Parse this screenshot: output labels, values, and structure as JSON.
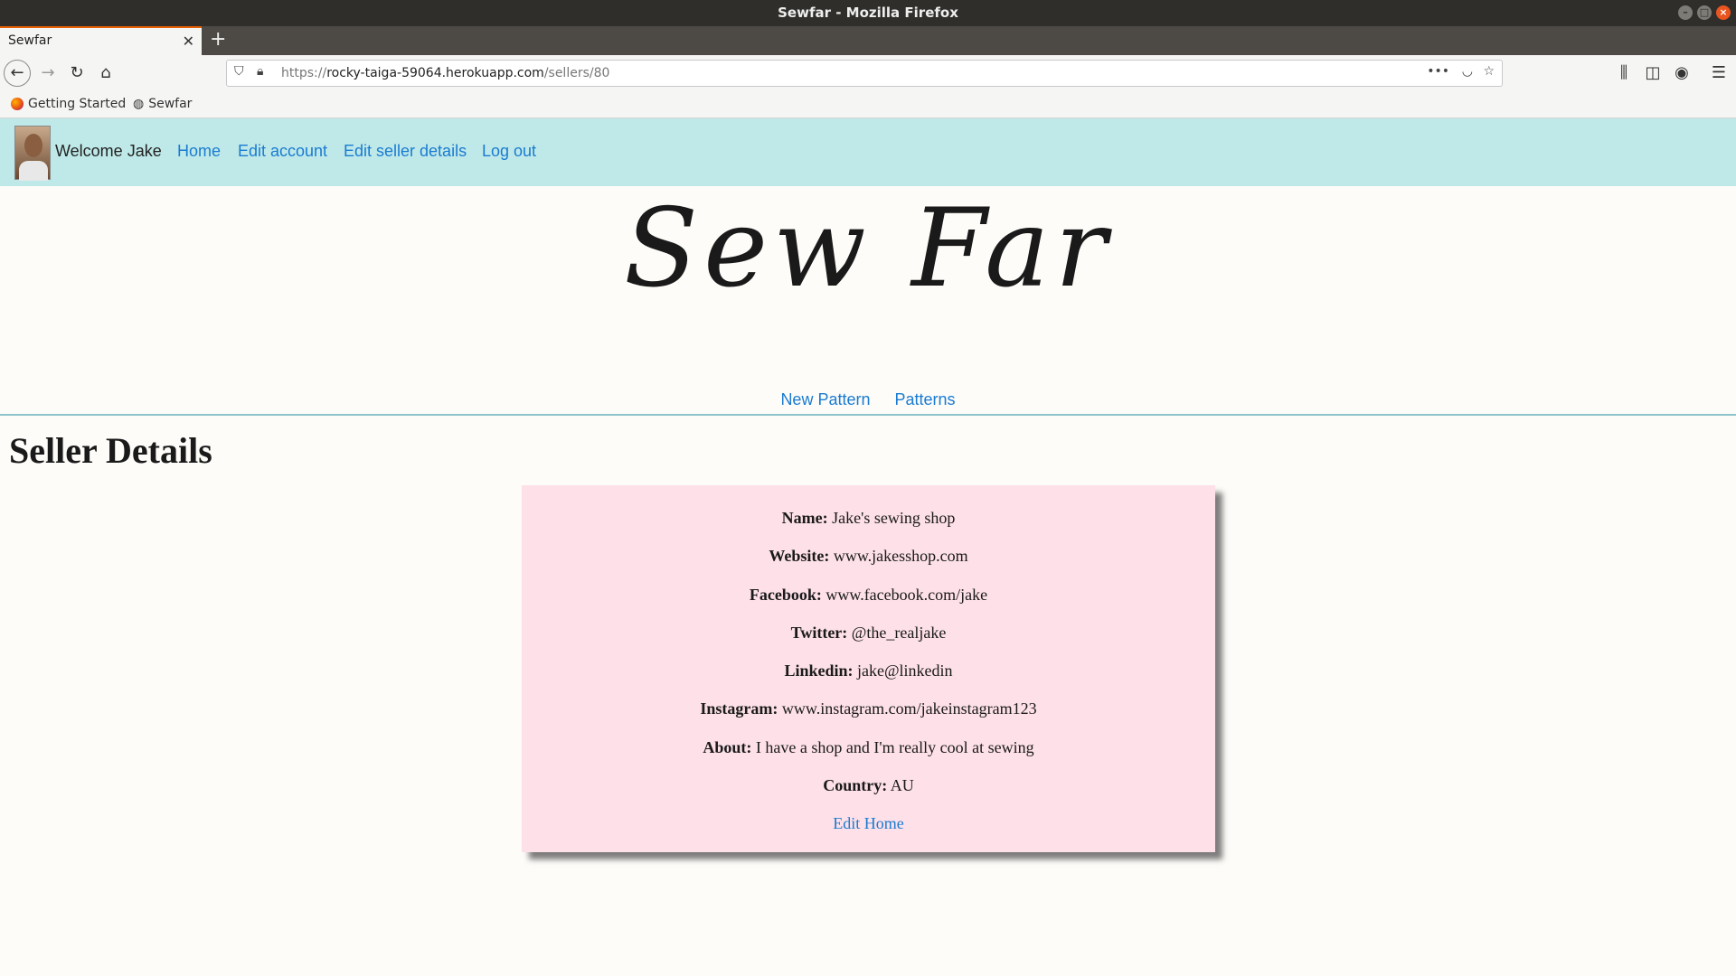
{
  "window": {
    "title": "Sewfar - Mozilla Firefox"
  },
  "browser": {
    "tab_title": "Sewfar",
    "url_scheme": "https://",
    "url_host": "rocky-taiga-59064.herokuapp.com",
    "url_path": "/sellers/80",
    "bookmarks": [
      "Getting Started",
      "Sewfar"
    ]
  },
  "header": {
    "welcome": "Welcome Jake",
    "links": [
      "Home",
      "Edit account",
      "Edit seller details",
      "Log out"
    ]
  },
  "logo": {
    "text": "Sew Far"
  },
  "subnav": {
    "links": [
      "New Pattern",
      "Patterns"
    ]
  },
  "page": {
    "title": "Seller Details"
  },
  "seller": {
    "fields": [
      {
        "label": "Name:",
        "value": "Jake's sewing shop"
      },
      {
        "label": "Website:",
        "value": "www.jakesshop.com"
      },
      {
        "label": "Facebook:",
        "value": "www.facebook.com/jake"
      },
      {
        "label": "Twitter:",
        "value": "@the_realjake"
      },
      {
        "label": "Linkedin:",
        "value": "jake@linkedin"
      },
      {
        "label": "Instagram:",
        "value": "www.instagram.com/jakeinstagram123"
      },
      {
        "label": "About:",
        "value": "I have a shop and I'm really cool at sewing"
      },
      {
        "label": "Country:",
        "value": "AU"
      }
    ],
    "edit_link": "Edit",
    "home_link": "Home"
  },
  "colors": {
    "header_bg": "#bfe9e8",
    "card_bg": "#fde0e8",
    "link": "#1a7bd1"
  }
}
